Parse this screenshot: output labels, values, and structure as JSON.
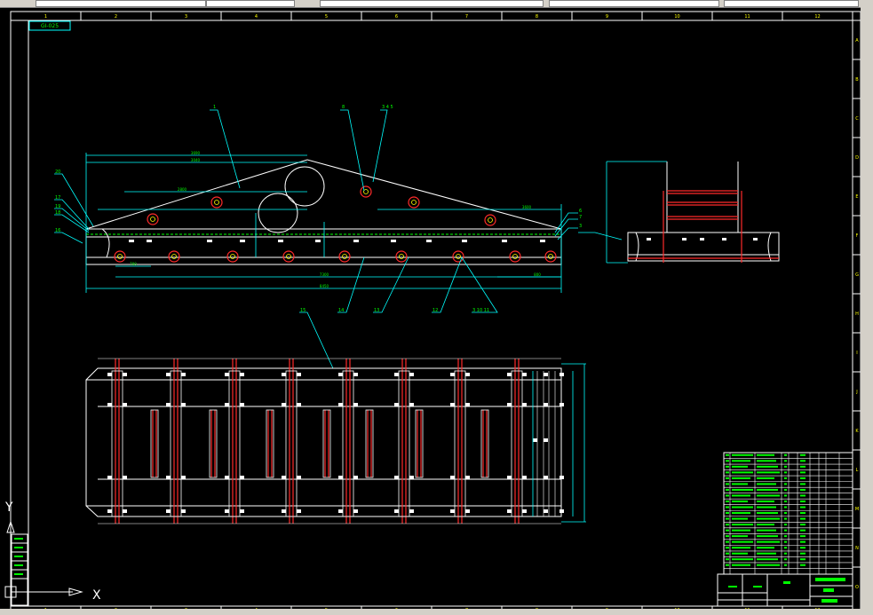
{
  "drawing": {
    "title_tag": "GI-025",
    "grid_cols": [
      "1",
      "2",
      "3",
      "4",
      "5",
      "6",
      "7",
      "8",
      "9",
      "10",
      "11",
      "12"
    ],
    "grid_rows": [
      "A",
      "B",
      "C",
      "D",
      "E",
      "F",
      "G",
      "H",
      "I",
      "J",
      "K",
      "L",
      "M",
      "N",
      "O"
    ],
    "balloons": {
      "b1": "1",
      "b8": "8",
      "b345": "3  4  5",
      "b20": "20",
      "b17": "17",
      "b19": "19",
      "b18": "18",
      "b16": "16",
      "b6": "6",
      "b7": "7",
      "b3": "3",
      "b14": "14",
      "b13": "13",
      "b12": "12",
      "b3911": "3  10  11",
      "b15": "15"
    },
    "dims": {
      "overall_top": "3690",
      "overall_2": "3040",
      "d_left": "2800",
      "d_right": "3600",
      "d_bottom": "7300",
      "d_base": "8450",
      "d_r": "800",
      "d_small": "700"
    },
    "ucs": {
      "x": "X",
      "y": "Y"
    }
  },
  "colors": {
    "bg": "#000000",
    "cyan": "#00ffff",
    "green": "#00ff00",
    "white": "#ffffff",
    "red": "#ff2a2a",
    "yellow": "#ffff00"
  }
}
